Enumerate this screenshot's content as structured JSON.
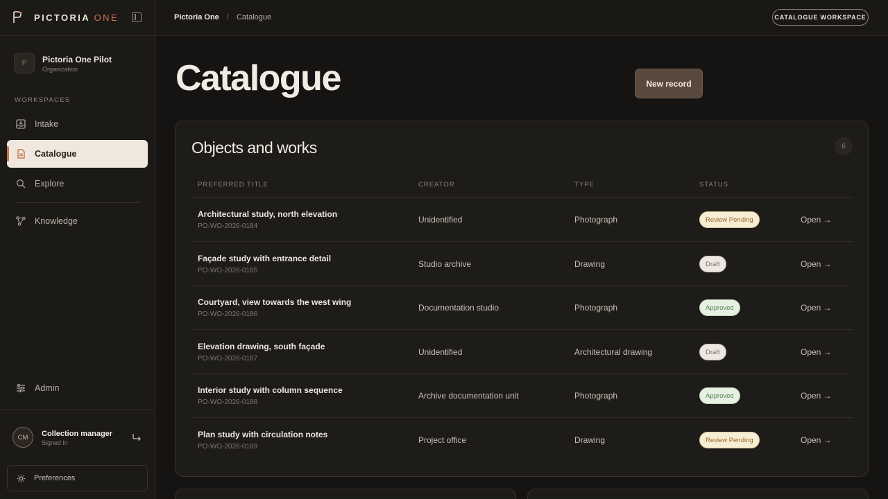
{
  "brand": {
    "name": "PICTORIA",
    "accent": "ONE",
    "accent_color": "#c9744f"
  },
  "sidebar": {
    "org": {
      "initial": "P",
      "name": "Pictoria One Pilot",
      "sub": "Organization"
    },
    "section_label": "WORKSPACES",
    "items": [
      {
        "label": "Intake",
        "icon": "inbox-icon"
      },
      {
        "label": "Catalogue",
        "icon": "document-icon",
        "active": true
      },
      {
        "label": "Explore",
        "icon": "search-icon"
      },
      {
        "label": "Knowledge",
        "icon": "graph-icon"
      }
    ],
    "admin": {
      "label": "Admin",
      "icon": "sliders-icon"
    },
    "user": {
      "initials": "CM",
      "name": "Collection manager",
      "sub": "Signed in"
    },
    "preferences": {
      "label": "Preferences",
      "icon": "sun-icon"
    }
  },
  "topbar": {
    "breadcrumb": [
      "Pictoria One",
      "Catalogue"
    ],
    "separator": "/",
    "workspace_button": "CATALOGUE WORKSPACE"
  },
  "main": {
    "title": "Catalogue",
    "new_record_label": "New record",
    "card": {
      "title": "Objects and works",
      "count": "6",
      "columns": [
        "PREFERRED TITLE",
        "CREATOR",
        "TYPE",
        "STATUS"
      ],
      "open_label": "Open →",
      "rows": [
        {
          "title": "Architectural study, north elevation",
          "id": "PO-WO-2026-0184",
          "creator": "Unidentified",
          "type": "Photograph",
          "status": "Review Pending",
          "status_kind": "pending"
        },
        {
          "title": "Façade study with entrance detail",
          "id": "PO-WO-2026-0185",
          "creator": "Studio archive",
          "type": "Drawing",
          "status": "Draft",
          "status_kind": "draft"
        },
        {
          "title": "Courtyard, view towards the west wing",
          "id": "PO-WO-2026-0186",
          "creator": "Documentation studio",
          "type": "Photograph",
          "status": "Approved",
          "status_kind": "approved"
        },
        {
          "title": "Elevation drawing, south façade",
          "id": "PO-WO-2026-0187",
          "creator": "Unidentified",
          "type": "Architectural drawing",
          "status": "Draft",
          "status_kind": "draft"
        },
        {
          "title": "Interior study with column sequence",
          "id": "PO-WO-2026-0188",
          "creator": "Archive documentation unit",
          "type": "Photograph",
          "status": "Approved",
          "status_kind": "approved"
        },
        {
          "title": "Plan study with circulation notes",
          "id": "PO-WO-2026-0189",
          "creator": "Project office",
          "type": "Drawing",
          "status": "Review Pending",
          "status_kind": "pending"
        }
      ]
    }
  }
}
